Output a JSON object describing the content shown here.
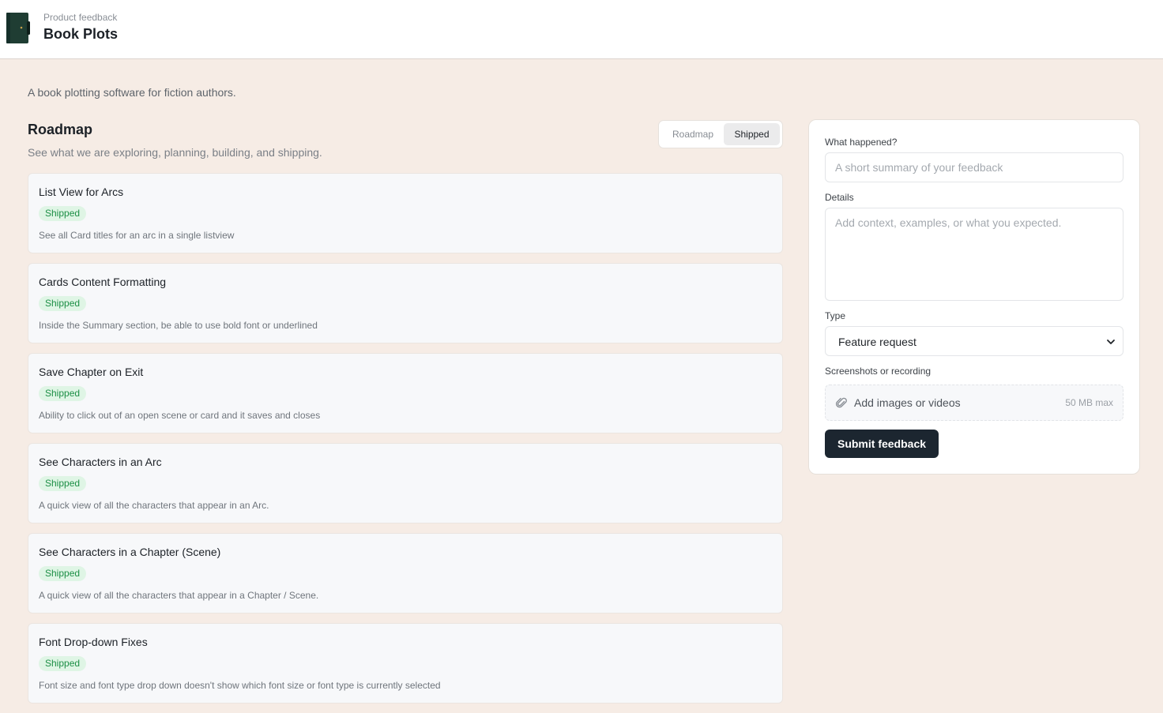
{
  "header": {
    "org_label": "Product feedback",
    "product_name": "Book Plots"
  },
  "intro": {
    "description": "A book plotting software for fiction authors."
  },
  "roadmap": {
    "title": "Roadmap",
    "subtitle": "See what we are exploring, planning, building, and shipping.",
    "toggle": {
      "options": [
        "Roadmap",
        "Shipped"
      ],
      "selected": "Shipped"
    },
    "items": [
      {
        "title": "List View for Arcs",
        "status": "Shipped",
        "description": "See all Card titles for an arc in a single listview"
      },
      {
        "title": "Cards Content Formatting",
        "status": "Shipped",
        "description": "Inside the Summary section, be able to use bold font or underlined"
      },
      {
        "title": "Save Chapter on Exit",
        "status": "Shipped",
        "description": "Ability to click out of an open scene or card and it saves and closes"
      },
      {
        "title": "See Characters in an Arc",
        "status": "Shipped",
        "description": "A quick view of all the characters that appear in an Arc."
      },
      {
        "title": "See Characters in a Chapter (Scene)",
        "status": "Shipped",
        "description": "A quick view of all the characters that appear in a Chapter / Scene."
      },
      {
        "title": "Font Drop-down Fixes",
        "status": "Shipped",
        "description": "Font size and font type drop down doesn't show which font size or font type is currently selected"
      }
    ]
  },
  "feedback_form": {
    "summary_label": "What happened?",
    "summary_placeholder": "A short summary of your feedback",
    "summary_value": "",
    "details_label": "Details",
    "details_placeholder": "Add context, examples, or what you expected.",
    "details_value": "",
    "type_label": "Type",
    "type_value": "Feature request",
    "upload_label": "Screenshots or recording",
    "upload_text": "Add images or videos",
    "upload_limit": "50 MB max",
    "submit_label": "Submit feedback"
  },
  "colors": {
    "page_background": "#f6ece5",
    "badge_text": "#1d8f46",
    "badge_background": "#dff5e5",
    "primary_button": "#1c2630"
  },
  "icons": {
    "logo": "notebook-icon",
    "select": "chevron-down-icon",
    "upload": "paperclip-icon"
  }
}
